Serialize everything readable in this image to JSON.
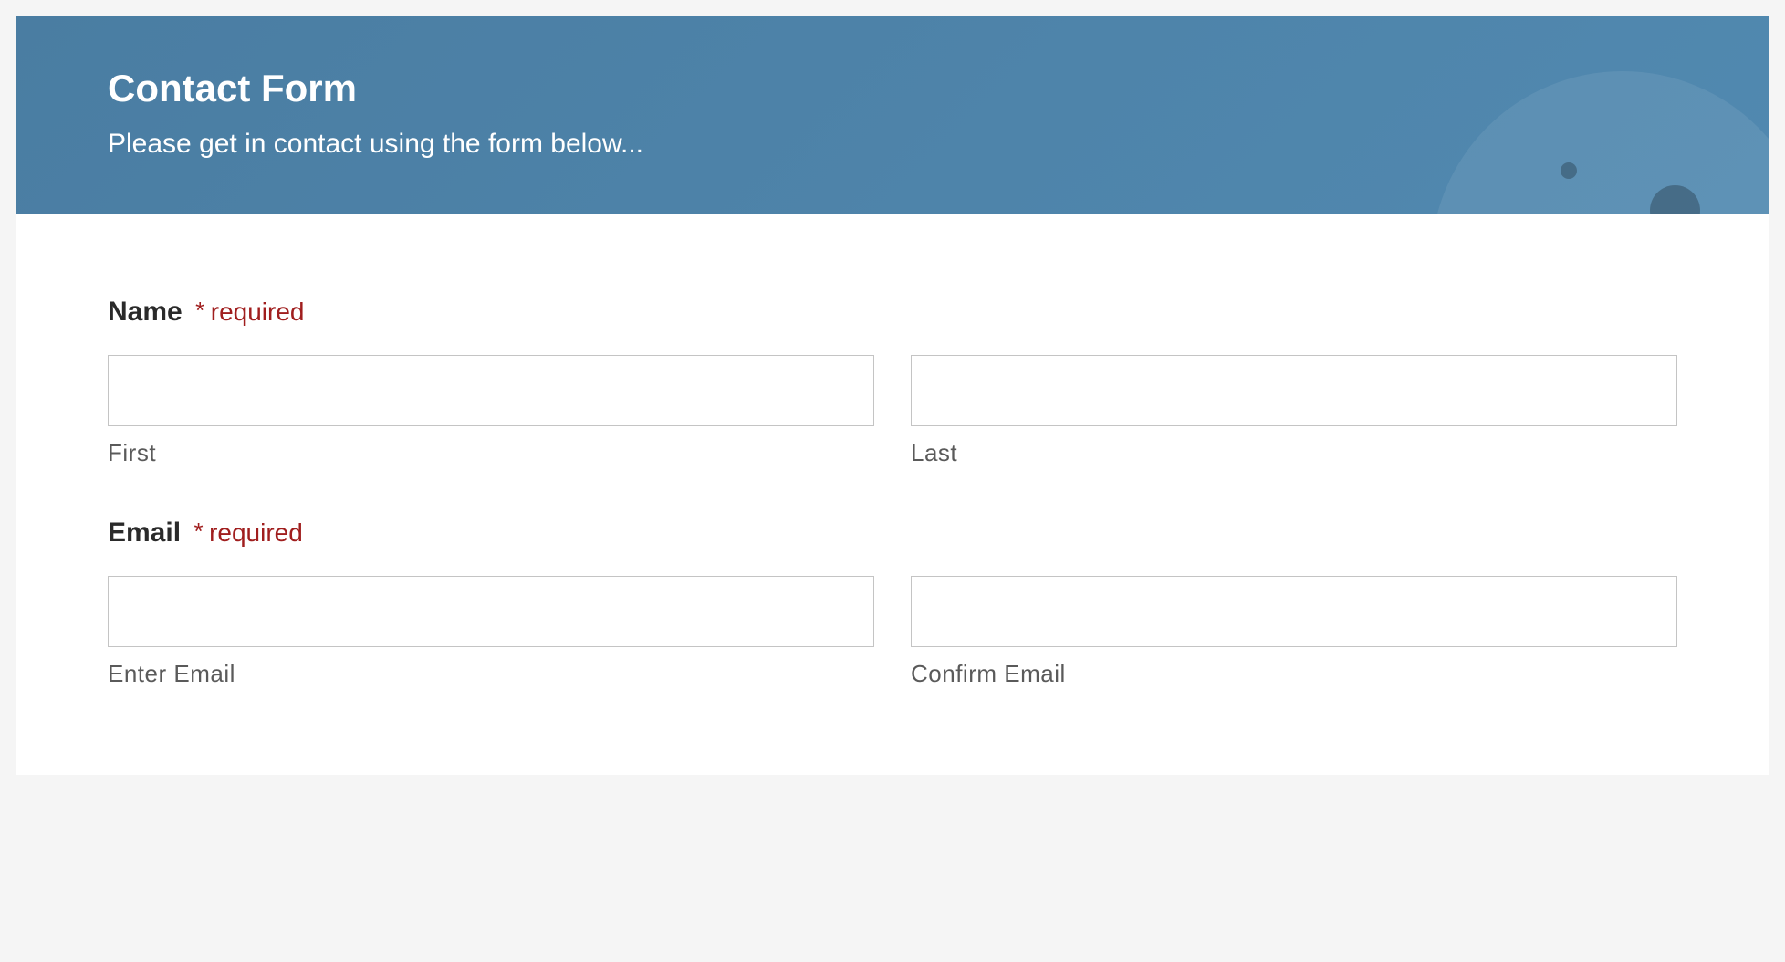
{
  "header": {
    "title": "Contact Form",
    "subtitle": "Please get in contact using the form below..."
  },
  "fields": {
    "name": {
      "label": "Name",
      "required_marker": "*",
      "required_text": "required",
      "first": {
        "sublabel": "First",
        "value": ""
      },
      "last": {
        "sublabel": "Last",
        "value": ""
      }
    },
    "email": {
      "label": "Email",
      "required_marker": "*",
      "required_text": "required",
      "enter": {
        "sublabel": "Enter Email",
        "value": ""
      },
      "confirm": {
        "sublabel": "Confirm Email",
        "value": ""
      }
    }
  }
}
